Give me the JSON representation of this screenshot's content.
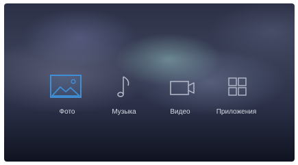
{
  "menu": {
    "items": [
      {
        "label": "Фото",
        "icon": "photo-icon",
        "selected": true
      },
      {
        "label": "Музыка",
        "icon": "music-note-icon",
        "selected": false
      },
      {
        "label": "Видео",
        "icon": "video-camera-icon",
        "selected": false
      },
      {
        "label": "Приложения",
        "icon": "apps-grid-icon",
        "selected": false
      }
    ]
  },
  "colors": {
    "selected_icon": "#3f8fd6",
    "icon": "#b8bccb",
    "label": "#d8dae4"
  }
}
